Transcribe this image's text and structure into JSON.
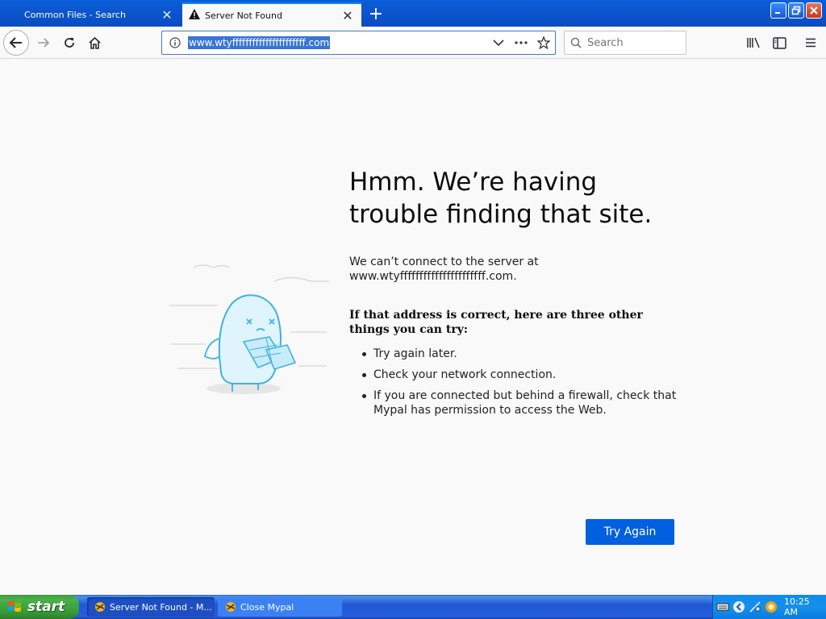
{
  "tabs": [
    {
      "title": "Common Files - Search",
      "active": false
    },
    {
      "title": "Server Not Found",
      "active": true
    }
  ],
  "toolbar": {
    "url": "www.wtyffffffffffffffffffffff.com",
    "search_placeholder": "Search"
  },
  "error_page": {
    "title": "Hmm. We’re having trouble finding that site.",
    "description": "We can’t connect to the server at www.wtyffffffffffffffffffffff.com.",
    "suggest_heading": "If that address is correct, here are three other things you can try:",
    "suggestions": [
      "Try again later.",
      "Check your network connection.",
      "If you are connected but behind a firewall, check that Mypal has permission to access the Web."
    ],
    "try_again_label": "Try Again"
  },
  "taskbar": {
    "start_label": "start",
    "items": [
      {
        "label": "Server Not Found - M..."
      },
      {
        "label": "Close Mypal"
      }
    ],
    "clock": "10:25 AM"
  },
  "colors": {
    "accent": "#0060df",
    "tabbar": "#0b56cf",
    "taskbar": "#245edb",
    "start_green": "#3c9a3c"
  }
}
